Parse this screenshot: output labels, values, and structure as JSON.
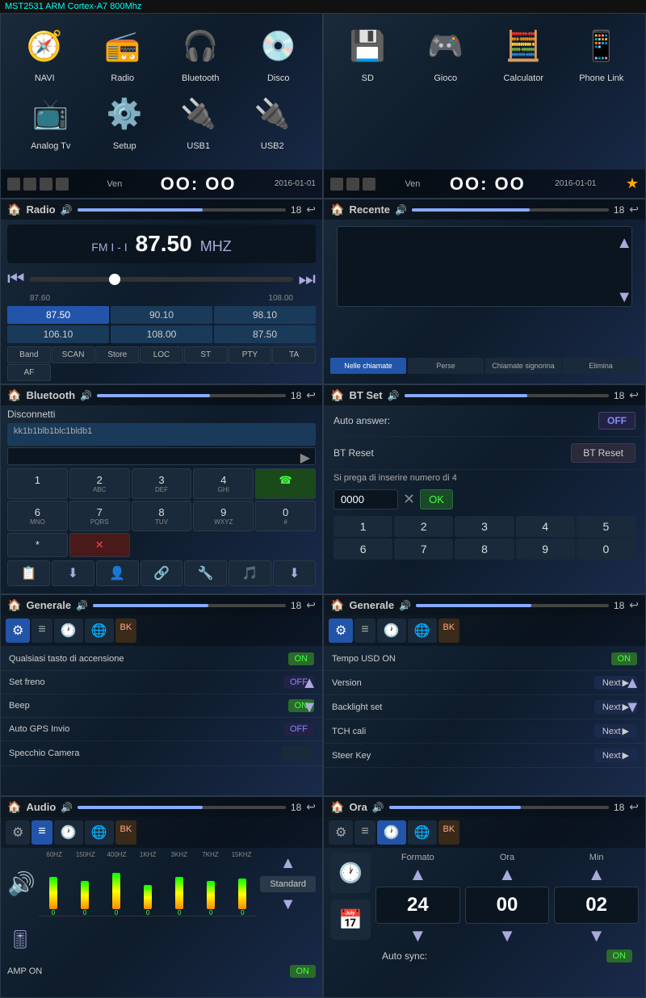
{
  "topBar": {
    "text": "MST2531 ARM Cortex-A7 800Mhz"
  },
  "row1": {
    "left": {
      "apps": [
        {
          "label": "NAVI",
          "icon": "🧭"
        },
        {
          "label": "Radio",
          "icon": "📻"
        },
        {
          "label": "Bluetooth",
          "icon": "🎧"
        },
        {
          "label": "Disco",
          "icon": "💿"
        },
        {
          "label": "Analog Tv",
          "icon": "📺"
        },
        {
          "label": "Setup",
          "icon": "⚙️"
        },
        {
          "label": "USB1",
          "icon": "🔌"
        },
        {
          "label": "USB2",
          "icon": "🔌"
        }
      ],
      "clock": "OO: OO",
      "date": "2016-01-01",
      "day": "Ven"
    },
    "right": {
      "apps": [
        {
          "label": "SD",
          "icon": "💾"
        },
        {
          "label": "Gioco",
          "icon": "🎮"
        },
        {
          "label": "Calculator",
          "icon": "🧮"
        },
        {
          "label": "Phone Link",
          "icon": "📱"
        }
      ],
      "clock": "OO: OO",
      "date": "2016-01-01",
      "day": "Ven"
    }
  },
  "row2": {
    "left": {
      "title": "Radio",
      "band": "FM I - I",
      "freq": "87.50",
      "unit": "MHZ",
      "scaleMin": "87.60",
      "scaleMax": "108.00",
      "freqs": [
        "87.50",
        "90.10",
        "98.10",
        "106.10",
        "108.00",
        "87.50"
      ],
      "controls": [
        "Band",
        "SCAN",
        "Store",
        "LOC",
        "ST",
        "PTY",
        "TA",
        "AF"
      ]
    },
    "right": {
      "title": "Recente",
      "tabs": [
        "Nelle chiamate",
        "Perse",
        "Chiamate signorina",
        "Elimina"
      ]
    }
  },
  "row3": {
    "left": {
      "title": "Bluetooth",
      "disconnectLabel": "Disconnetti",
      "deviceId": "kk1b1blb1blc1bldb1",
      "numpad": [
        {
          "num": "1",
          "sub": ""
        },
        {
          "num": "2",
          "sub": "ABC"
        },
        {
          "num": "3",
          "sub": "DEF"
        },
        {
          "num": "4",
          "sub": "GHI"
        },
        {
          "num": "☎",
          "sub": "",
          "type": "green"
        },
        {
          "num": "6",
          "sub": "MNO"
        },
        {
          "num": "7",
          "sub": "PQRS"
        },
        {
          "num": "8",
          "sub": "TUV"
        },
        {
          "num": "9",
          "sub": "WXYZ"
        },
        {
          "num": "0",
          "sub": "#"
        },
        {
          "num": "*",
          "sub": ""
        },
        {
          "num": "✕",
          "sub": "",
          "type": "red"
        }
      ]
    },
    "right": {
      "title": "BT Set",
      "autoAnswerLabel": "Auto answer:",
      "autoAnswerValue": "OFF",
      "btResetLabel": "BT Reset",
      "btResetBtn": "BT Reset",
      "pinNote": "Si prega di inserire numero di 4",
      "pinValue": "0000",
      "numrow": [
        "1",
        "2",
        "3",
        "4",
        "5",
        "6",
        "7",
        "8",
        "9",
        "0"
      ],
      "okBtn": "OK"
    }
  },
  "row4": {
    "left": {
      "title": "Generale",
      "rows": [
        {
          "label": "Qualsiasi tasto di accensione",
          "value": "ON",
          "type": "on"
        },
        {
          "label": "Set freno",
          "value": "OFF",
          "type": "off"
        },
        {
          "label": "Beep",
          "value": "ON",
          "type": "on"
        },
        {
          "label": "Auto GPS Invio",
          "value": "OFF",
          "type": "off"
        },
        {
          "label": "Specchio Camera",
          "value": "",
          "type": "none"
        }
      ]
    },
    "right": {
      "title": "Generale",
      "rows": [
        {
          "label": "Tempo USD ON",
          "value": "ON",
          "type": "on"
        },
        {
          "label": "Version",
          "value": "Next",
          "type": "next"
        },
        {
          "label": "Backlight set",
          "value": "Next",
          "type": "next"
        },
        {
          "label": "TCH cali",
          "value": "Next",
          "type": "next"
        },
        {
          "label": "Steer Key",
          "value": "Next",
          "type": "next"
        }
      ]
    }
  },
  "row5": {
    "left": {
      "title": "Audio",
      "eqBands": [
        "60HZ",
        "150HZ",
        "400HZ",
        "1KHZ",
        "3KHZ",
        "7KHZ",
        "15KHZ"
      ],
      "eqValues": [
        0,
        0,
        0,
        0,
        0,
        0,
        0
      ],
      "eqHeights": [
        40,
        35,
        45,
        30,
        40,
        35,
        38
      ],
      "preset": "Standard",
      "ampLabel": "AMP ON",
      "ampValue": "ON"
    },
    "right": {
      "title": "Ora",
      "formatoLabel": "Formato",
      "oraLabel": "Ora",
      "minLabel": "Min",
      "formatoValue": "24",
      "oraValue": "00",
      "minValue": "02",
      "autoSyncLabel": "Auto sync:",
      "autoSyncValue": "ON"
    }
  }
}
